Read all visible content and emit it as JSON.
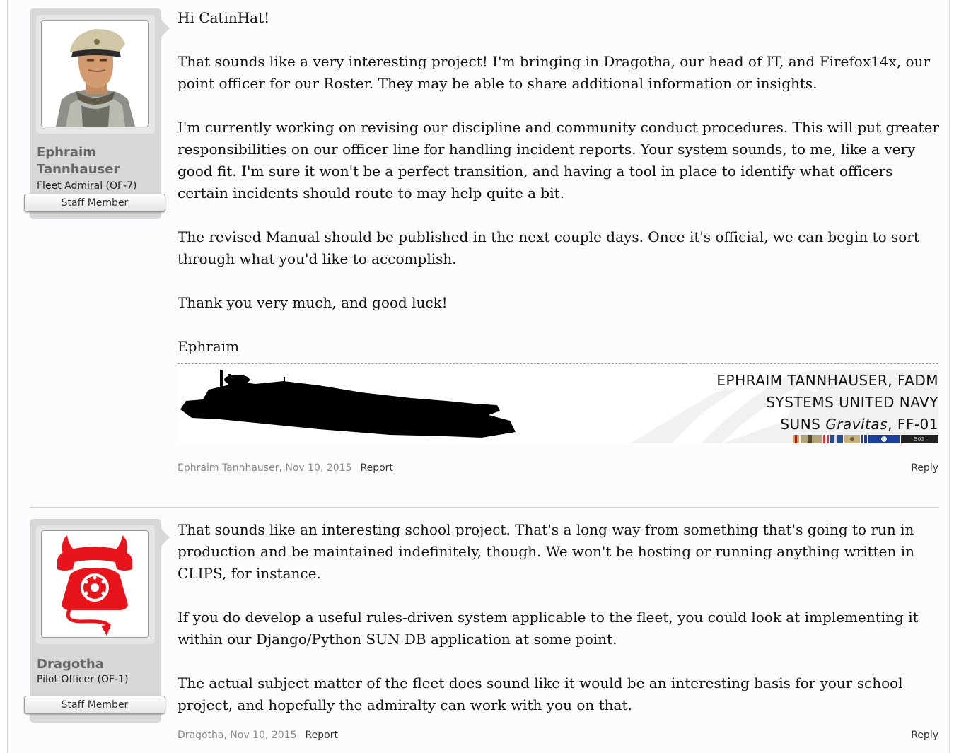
{
  "posts": [
    {
      "user": {
        "name_line1": "Ephraim",
        "name_line2": "Tannhauser",
        "title": "Fleet Admiral (OF-7)",
        "badge": "Staff Member",
        "avatar_icon": "officer-portrait"
      },
      "paragraphs": [
        "Hi CatinHat!",
        "That sounds like a very interesting project! I'm bringing in Dragotha, our head of IT, and Firefox14x, our point officer for our Roster. They may be able to share additional information or insights.",
        "I'm currently working on revising our discipline and community conduct procedures. This will put greater responsibilities on our officer line for handling incident reports. Your system sounds, to me, like a very good fit. I'm sure it won't be a perfect transition, and having a tool in place to identify what officers certain incidents should route to may help quite a bit.",
        "The revised Manual should be published in the next couple days. Once it's official, we can begin to sort through what you'd like to accomplish.",
        "Thank you very much, and good luck!",
        "Ephraim"
      ],
      "signature": {
        "line1": "EPHRAIM TANNHAUSER, FADM",
        "line2": "SYSTEMS UNITED NAVY",
        "line3_prefix": "SUNS ",
        "line3_italic": "Gravitas",
        "line3_suffix": ", FF-01",
        "ribbon_number": "503",
        "ship_icon": "starship-silhouette"
      },
      "meta": {
        "author_date": "Ephraim Tannhauser, Nov 10, 2015",
        "report": "Report",
        "reply": "Reply"
      }
    },
    {
      "user": {
        "name_line1": "Dragotha",
        "title": "Pilot Officer (OF-1)",
        "badge": "Staff Member",
        "avatar_icon": "devil-telephone"
      },
      "paragraphs": [
        "That sounds like an interesting school project. That's a long way from something that's going to run in production and be maintained indefinitely, though. We won't be hosting or running anything written in CLIPS, for instance.",
        "If you do develop a useful rules-driven system applicable to the fleet, you could look at implementing it within our Django/Python SUN DB application at some point.",
        "The actual subject matter of the fleet does sound like it would be an interesting basis for your school project, and hopefully the admiralty can work with you on that."
      ],
      "meta": {
        "author_date": "Dragotha, Nov 10, 2015",
        "report": "Report",
        "reply": "Reply"
      }
    }
  ],
  "colors": {
    "user_panel": "#d7d7d7",
    "devil_red": "#e8141b",
    "meta_gray": "#8a8a8a"
  }
}
